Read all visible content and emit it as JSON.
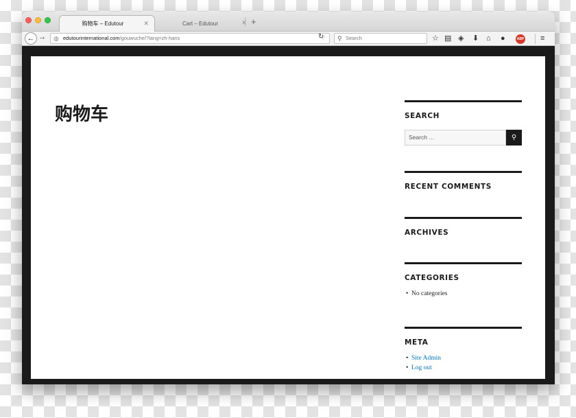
{
  "browser": {
    "tabs": [
      {
        "title": "购物车 – Edutour",
        "active": true
      },
      {
        "title": "Cart – Edutour",
        "active": false
      }
    ],
    "new_tab": "+",
    "url_domain": "edutourinternational.com",
    "url_path": "/gouwuche/?lang=zh-hans",
    "search_placeholder": "Search"
  },
  "page": {
    "title": "购物车"
  },
  "sidebar": {
    "search": {
      "title": "SEARCH",
      "placeholder": "Search …"
    },
    "recent_comments": {
      "title": "RECENT COMMENTS"
    },
    "archives": {
      "title": "ARCHIVES"
    },
    "categories": {
      "title": "CATEGORIES",
      "items": [
        "No categories"
      ]
    },
    "meta": {
      "title": "META",
      "links": [
        "Site Admin",
        "Log out"
      ]
    }
  },
  "colors": {
    "link": "#007acc",
    "text": "#1a1a1a",
    "frame": "#1a1a1a"
  }
}
